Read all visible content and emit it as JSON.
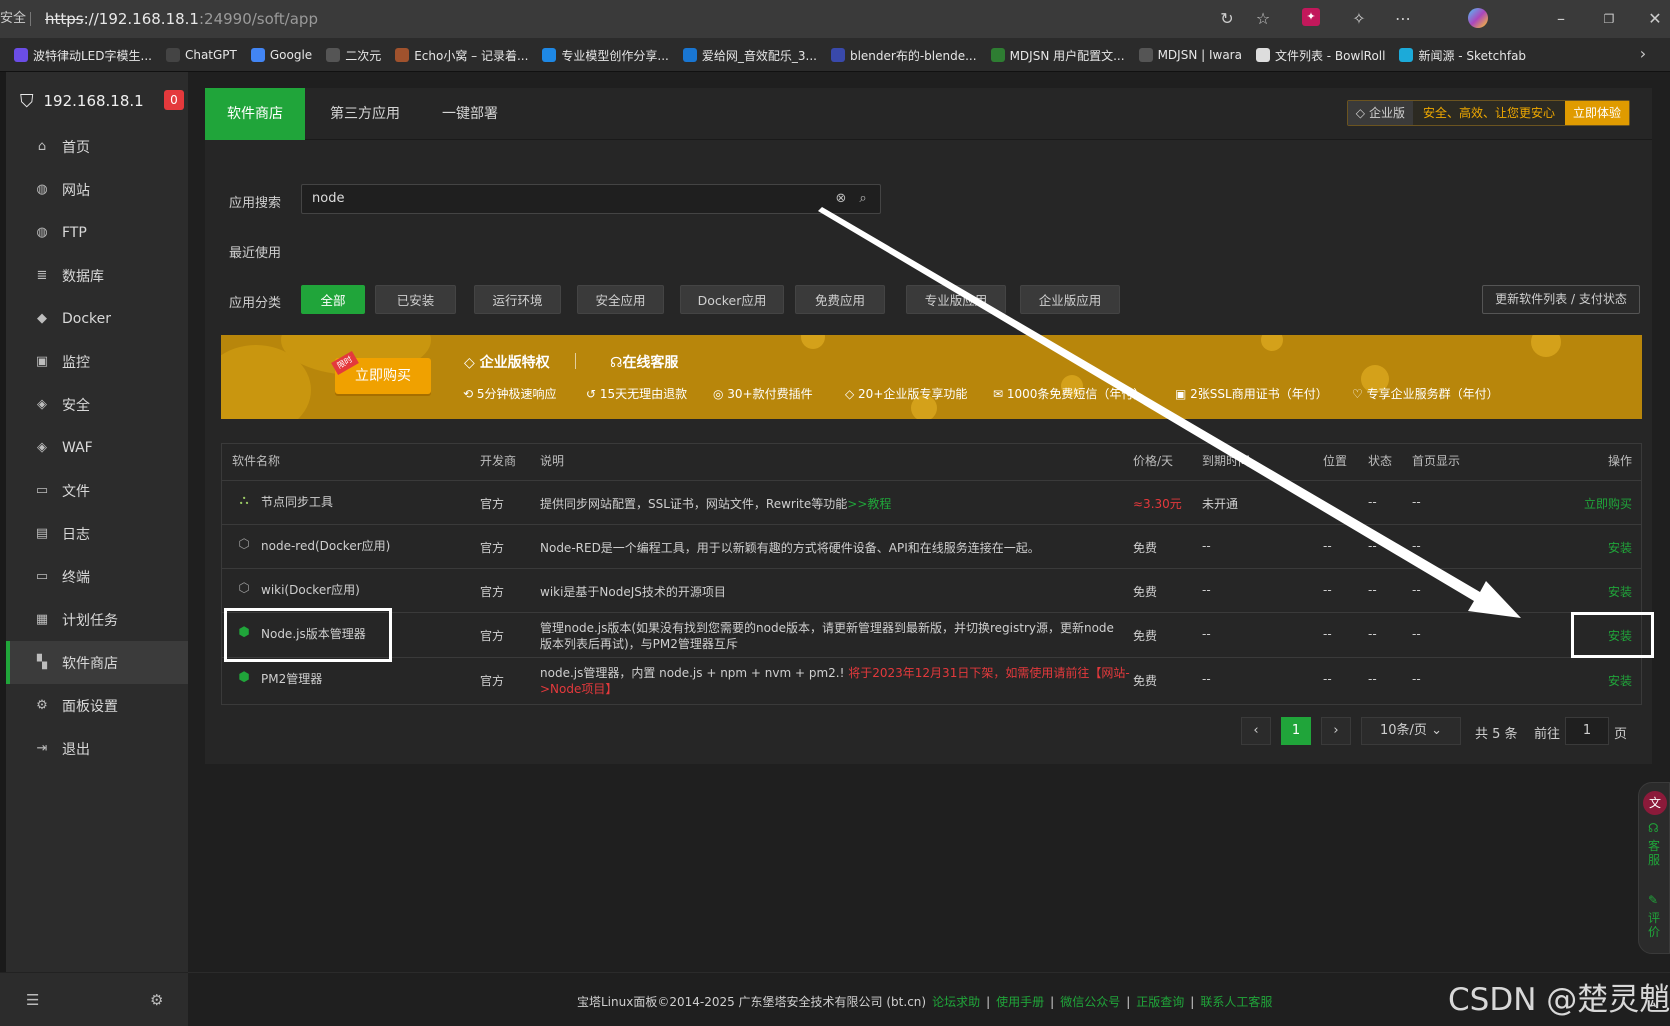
{
  "browser": {
    "security": "安全",
    "url_scheme": "https",
    "url_host": "://192.168.18.1",
    "url_rest": ":24990/soft/app",
    "bookmarks": [
      {
        "label": "波特律动LED字模生...",
        "icon": "v-logo-icon",
        "color": "#6b4de6"
      },
      {
        "label": "ChatGPT",
        "icon": "openai-icon",
        "color": "#444444"
      },
      {
        "label": "Google",
        "icon": "google-icon",
        "color": "#4285f4"
      },
      {
        "label": "二次元",
        "icon": "folder-icon",
        "color": "#555555"
      },
      {
        "label": "Echo小窝 – 记录着...",
        "icon": "avatar-icon",
        "color": "#a0522d"
      },
      {
        "label": "专业模型创作分享...",
        "icon": "model-site-icon",
        "color": "#1e88e5"
      },
      {
        "label": "爱给网_音效配乐_3...",
        "icon": "aigei-icon",
        "color": "#1976d2"
      },
      {
        "label": "blender布的-blende...",
        "icon": "b-logo-icon",
        "color": "#3949ab"
      },
      {
        "label": "MDJSN 用户配置文...",
        "icon": "mdjsn-icon",
        "color": "#2e7d32"
      },
      {
        "label": "MDJSN | Iwara",
        "icon": "iwara-icon",
        "color": "#555555"
      },
      {
        "label": "文件列表 - BowlRoll",
        "icon": "bowlroll-icon",
        "color": "#dddddd"
      },
      {
        "label": "新闻源 - Sketchfab",
        "icon": "sketchfab-icon",
        "color": "#1caad9"
      }
    ]
  },
  "sidebar": {
    "host": "192.168.18.1",
    "badge": "0",
    "items": [
      {
        "label": "首页",
        "icon": "home-icon",
        "glyph": "⌂"
      },
      {
        "label": "网站",
        "icon": "globe-icon",
        "glyph": "◍"
      },
      {
        "label": "FTP",
        "icon": "ftp-globe-icon",
        "glyph": "◍"
      },
      {
        "label": "数据库",
        "icon": "database-icon",
        "glyph": "≣"
      },
      {
        "label": "Docker",
        "icon": "docker-icon",
        "glyph": "◆"
      },
      {
        "label": "监控",
        "icon": "monitor-icon",
        "glyph": "▣"
      },
      {
        "label": "安全",
        "icon": "shield-icon",
        "glyph": "◈"
      },
      {
        "label": "WAF",
        "icon": "waf-shield-icon",
        "glyph": "◈"
      },
      {
        "label": "文件",
        "icon": "folder-icon",
        "glyph": "▭"
      },
      {
        "label": "日志",
        "icon": "log-icon",
        "glyph": "▤"
      },
      {
        "label": "终端",
        "icon": "terminal-icon",
        "glyph": "▭"
      },
      {
        "label": "计划任务",
        "icon": "calendar-icon",
        "glyph": "▦"
      },
      {
        "label": "软件商店",
        "icon": "apps-grid-icon",
        "glyph": "▚",
        "active": true
      },
      {
        "label": "面板设置",
        "icon": "gear-icon",
        "glyph": "⚙"
      },
      {
        "label": "退出",
        "icon": "logout-icon",
        "glyph": "⇥"
      }
    ]
  },
  "tabs": [
    "软件商店",
    "第三方应用",
    "一键部署"
  ],
  "promo_top": {
    "edition": "企业版",
    "slogan": "安全、高效、让您更安心",
    "try": "立即体验"
  },
  "search": {
    "label": "应用搜索",
    "value": "node"
  },
  "recent": {
    "label": "最近使用"
  },
  "categories": {
    "label": "应用分类",
    "items": [
      "全部",
      "已安装",
      "运行环境",
      "安全应用",
      "Docker应用",
      "免费应用",
      "专业版应用",
      "企业版应用"
    ],
    "refresh": "更新软件列表 / 支付状态"
  },
  "banner": {
    "buy": "立即购买",
    "tag": "限时",
    "privilege": "企业版特权",
    "service": "在线客服",
    "features": [
      "5分钟极速响应",
      "15天无理由退款",
      "30+款付费插件",
      "20+企业版专享功能",
      "1000条免费短信（年付）",
      "2张SSL商用证书（年付）",
      "专享企业服务群（年付）"
    ]
  },
  "table": {
    "headers": [
      "软件名称",
      "开发商",
      "说明",
      "价格/天",
      "到期时间",
      "位置",
      "状态",
      "首页显示",
      "操作"
    ],
    "rows": [
      {
        "name": "节点同步工具",
        "dev": "官方",
        "desc": "提供同步网站配置，SSL证书，网站文件，Rewrite等功能",
        "desc_link": ">>教程",
        "desc_red": "",
        "desc2": "",
        "price": "≈3.30元",
        "expire": "未开通",
        "pos": "",
        "status": "--",
        "home": "--",
        "action": "立即购买"
      },
      {
        "name": "node-red(Docker应用)",
        "dev": "官方",
        "desc": "Node-RED是一个编程工具，用于以新颖有趣的方式将硬件设备、API和在线服务连接在一起。",
        "desc_link": "",
        "desc_red": "",
        "desc2": "",
        "price": "免费",
        "expire": "--",
        "pos": "--",
        "status": "--",
        "home": "--",
        "action": "安装"
      },
      {
        "name": "wiki(Docker应用)",
        "dev": "官方",
        "desc": "wiki是基于NodeJS技术的开源项目",
        "desc_link": "",
        "desc_red": "",
        "desc2": "",
        "price": "免费",
        "expire": "--",
        "pos": "--",
        "status": "--",
        "home": "--",
        "action": "安装"
      },
      {
        "name": "Node.js版本管理器",
        "dev": "官方",
        "desc": "管理node.js版本(如果没有找到您需要的node版本，请更新管理器到最新版，并切换registry源，更新node",
        "desc_link": "",
        "desc_red": "",
        "desc2": "版本列表后再试)，与PM2管理器互斥",
        "price": "免费",
        "expire": "--",
        "pos": "--",
        "status": "--",
        "home": "--",
        "action": "安装"
      },
      {
        "name": "PM2管理器",
        "dev": "官方",
        "desc": "node.js管理器，内置 node.js + npm + nvm + pm2.!",
        "desc_link": "",
        "desc_red": " 将于2023年12月31日下架，如需使用请前往【网站-",
        "desc2": ">Node项目】",
        "price": "免费",
        "expire": "--",
        "pos": "--",
        "status": "--",
        "home": "--",
        "action": "安装"
      }
    ]
  },
  "pagination": {
    "prev": "‹",
    "page": "1",
    "next": "›",
    "per_page": "10条/页",
    "total": "共 5 条",
    "goto": "前往",
    "goto_val": "1",
    "unit": "页"
  },
  "footer": {
    "copyright": "宝塔Linux面板©2014-2025 广东堡塔安全技术有限公司 (bt.cn)",
    "links": [
      "论坛求助",
      "使用手册",
      "微信公众号",
      "正版查询",
      "联系人工客服"
    ],
    "sep": "|"
  },
  "side_float": {
    "service": "客服",
    "review": "评价"
  },
  "watermark": "CSDN @楚灵魈",
  "colors": {
    "accent": "#20a53a",
    "gold": "#f0a100",
    "danger": "#e4393c"
  }
}
